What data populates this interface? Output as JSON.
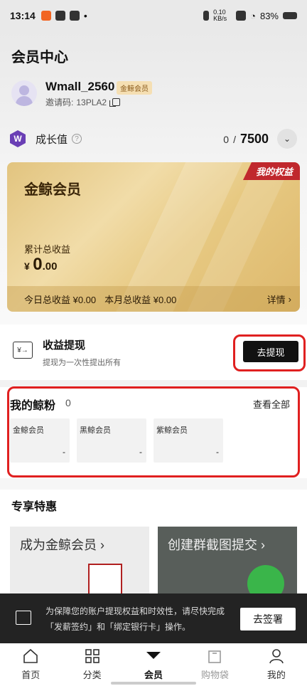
{
  "status_bar": {
    "time": "13:14",
    "network_speed": "0.10 KB/s",
    "battery": "83%"
  },
  "page": {
    "title": "会员中心"
  },
  "user": {
    "name": "Wmall_2560",
    "badge": "金鲸会员",
    "invite_label": "邀请码:",
    "invite_code": "13PLA2"
  },
  "growth": {
    "icon_letter": "W",
    "label": "成长值",
    "current": "0",
    "separator": "/",
    "max": "7500"
  },
  "card": {
    "tag": "我的权益",
    "title": "金鲸会员",
    "total_label": "累计总收益",
    "currency": "¥",
    "total_integer": "0",
    "total_decimal": ".00",
    "today": "今日总收益 ¥0.00",
    "month": "本月总收益 ¥0.00",
    "detail": "详情"
  },
  "withdraw": {
    "title": "收益提现",
    "subtitle": "提现为一次性提出所有",
    "button": "去提现"
  },
  "fans": {
    "title": "我的鲸粉",
    "count": "0",
    "view_all": "查看全部",
    "items": [
      {
        "label": "金鲸会员",
        "value": "-"
      },
      {
        "label": "黑鲸会员",
        "value": "-"
      },
      {
        "label": "紫鲸会员",
        "value": "-"
      }
    ]
  },
  "exclusive": {
    "title": "专享特惠",
    "promos": [
      {
        "text": "成为金鲸会员 ›"
      },
      {
        "text": "创建群截图提交 ›"
      }
    ]
  },
  "notice": {
    "text": "为保障您的账户提现权益和时效性，请尽快完成「发薪签约」和「绑定银行卡」操作。",
    "button": "去签署"
  },
  "tabbar": {
    "items": [
      {
        "label": "首页",
        "icon": "home-icon"
      },
      {
        "label": "分类",
        "icon": "grid-icon"
      },
      {
        "label": "会员",
        "icon": "member-icon"
      },
      {
        "label": "购物袋",
        "icon": "bag-icon"
      },
      {
        "label": "我的",
        "icon": "profile-icon"
      }
    ]
  },
  "colors": {
    "accent_red": "#e02020",
    "gold": "#e2c47f",
    "dark": "#111111"
  }
}
